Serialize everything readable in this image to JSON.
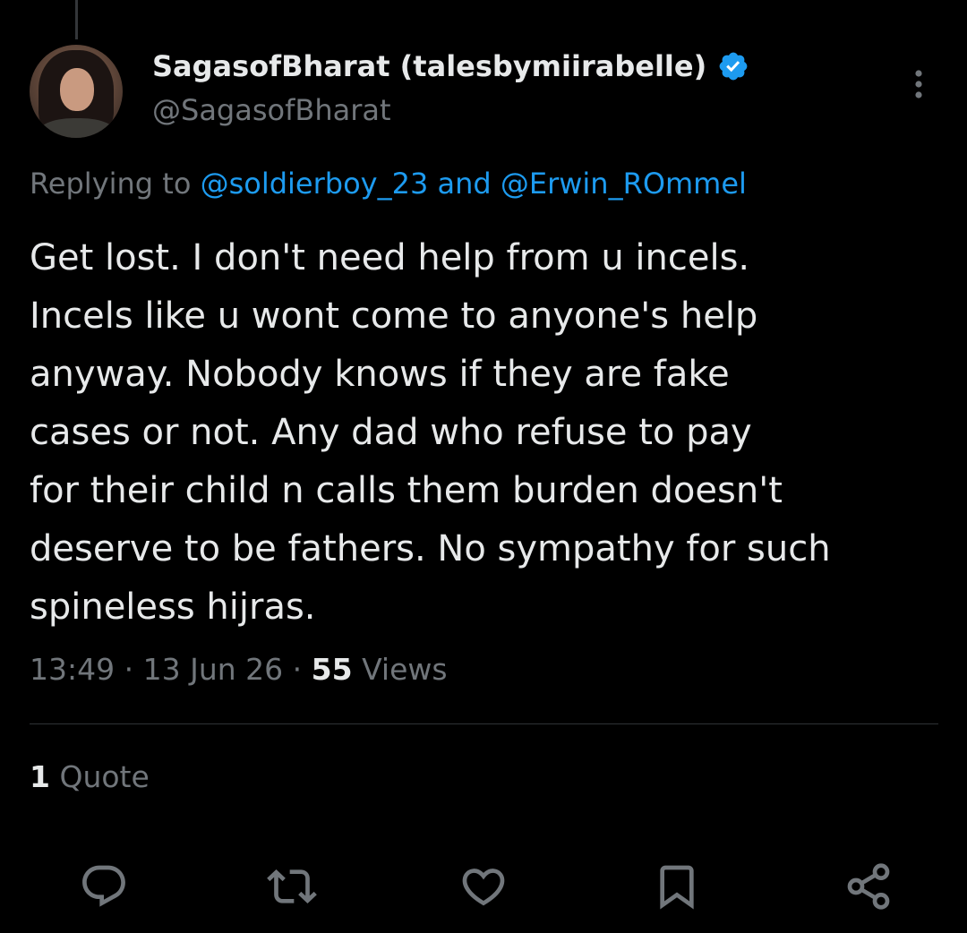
{
  "author": {
    "display_name": "SagasofBharat (talesbymiirabelle)",
    "handle": "@SagasofBharat",
    "verified_color": "#1d9bf0"
  },
  "reply": {
    "prefix": "Replying to",
    "mention_1": "@soldierboy_23",
    "conjunction": "and",
    "mention_2": "@Erwin_ROmmel"
  },
  "tweet": {
    "lines": [
      "Get lost. I don't need help from u incels.",
      "Incels like u wont come to anyone's help",
      "anyway. Nobody knows if they are fake",
      "cases or not. Any dad who refuse to pay",
      "for their child n calls them burden doesn't",
      "deserve to be fathers. No sympathy for such",
      "spineless hijras."
    ]
  },
  "meta": {
    "time": "13:49",
    "separator": "·",
    "date": "13 Jun 26",
    "views_count": "55",
    "views_label": "Views"
  },
  "stats": {
    "quote_count": "1",
    "quote_label": "Quote"
  },
  "actions": {
    "icons": [
      "reply-icon",
      "retweet-icon",
      "like-icon",
      "bookmark-icon",
      "share-icon"
    ]
  },
  "colors": {
    "background": "#000000",
    "text": "#e7e9ea",
    "muted": "#71767b",
    "link": "#1d9bf0",
    "divider": "#2f3336"
  }
}
